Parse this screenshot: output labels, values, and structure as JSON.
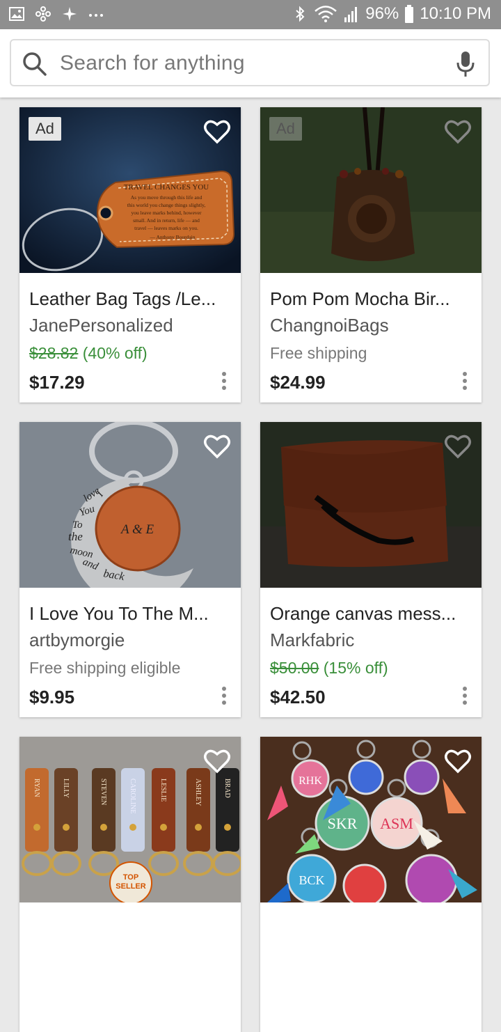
{
  "status_bar": {
    "battery": "96%",
    "time": "10:10 PM",
    "icons": [
      "gallery-icon",
      "pinwheel-icon",
      "plus-icon",
      "more-icon",
      "bluetooth-icon",
      "wifi-icon",
      "signal-icon",
      "battery-icon"
    ]
  },
  "search": {
    "placeholder": "Search for anything"
  },
  "listings": [
    {
      "title": "Leather Bag Tags /Le...",
      "shop": "JanePersonalized",
      "original_price": "$28.82",
      "discount": "(40% off)",
      "price": "$17.29",
      "ad": "Ad",
      "image_text": [
        "TRAVEL CHANGES YOU",
        "As you move through this life and",
        "this world you change things slightly,",
        "you leave marks behind, however",
        "small. And in return, life — and",
        "travel — leaves marks on you.",
        "— Anthony Bourdain"
      ]
    },
    {
      "title": "Pom Pom Mocha Bir...",
      "shop": "ChangnoiBags",
      "shipping": "Free shipping",
      "price": "$24.99",
      "ad": "Ad"
    },
    {
      "title": "I Love You To The M...",
      "shop": "artbymorgie",
      "shipping": "Free shipping eligible",
      "price": "$9.95",
      "image_text": [
        "I",
        "love",
        "You",
        "To",
        "the",
        "moon",
        "and",
        "back",
        "A & E"
      ]
    },
    {
      "title": "Orange canvas mess...",
      "shop": "Markfabric",
      "original_price": "$50.00",
      "discount": "(15% off)",
      "price": "$42.50"
    },
    {
      "image_text": [
        "RYAN",
        "LILLY",
        "STEVEN",
        "CAROLINE",
        "LESLIE",
        "ASHLEY",
        "BRAD",
        "TOP",
        "SELLER"
      ]
    },
    {
      "image_text": [
        "SKR",
        "ASM",
        "RHK",
        "BCK"
      ]
    }
  ]
}
